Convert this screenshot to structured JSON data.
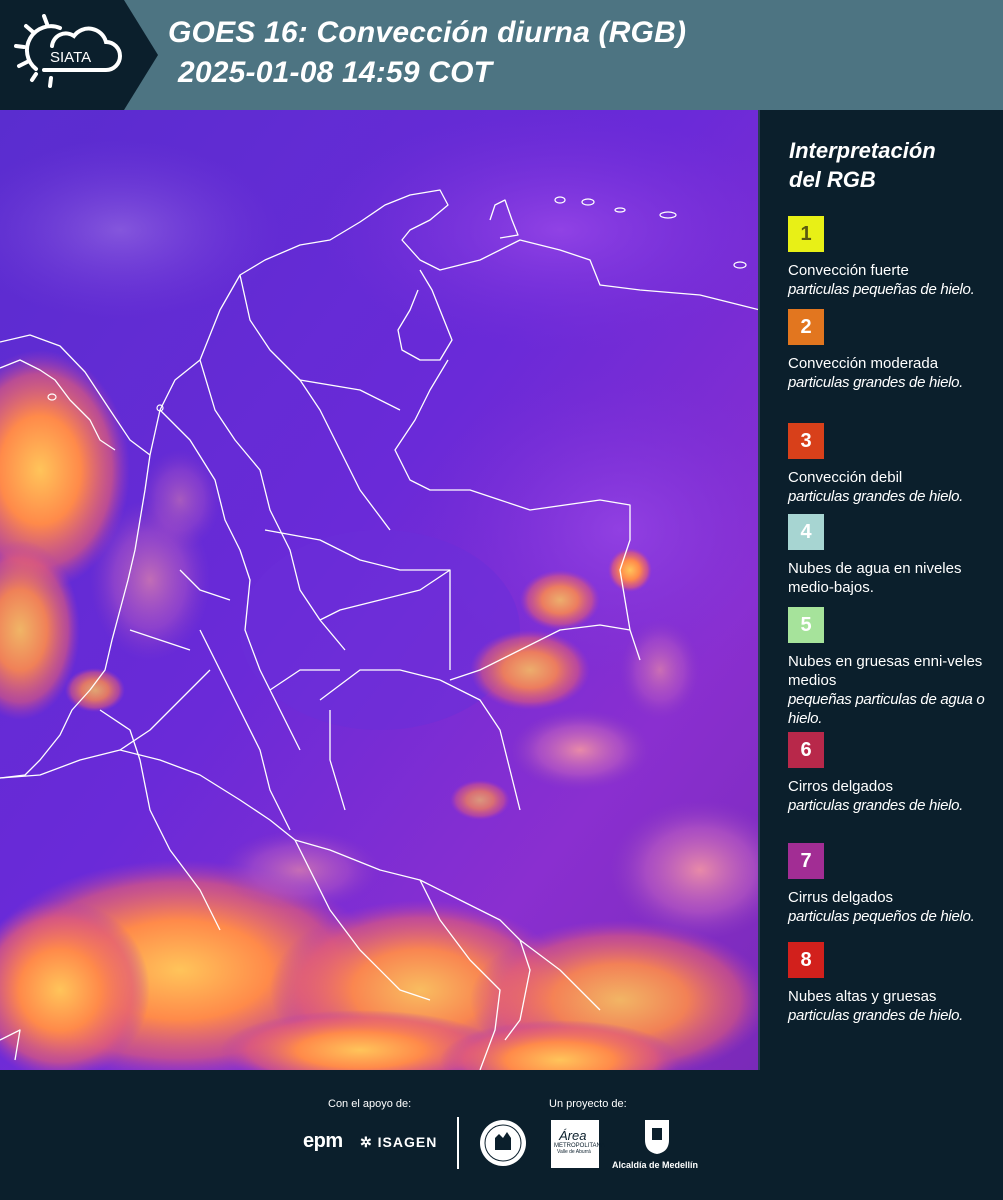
{
  "header": {
    "logo_text": "SIATA",
    "title_line1": "GOES 16: Convección diurna (RGB)",
    "title_line2": "2025-01-08 14:59 COT"
  },
  "legend": {
    "title_line1": "Interpretación",
    "title_line2": "del RGB",
    "items": [
      {
        "number": "1",
        "color": "#e8f016",
        "number_color": "#5a5a10",
        "name": "Convección fuerte",
        "desc": "particulas pequeñas de hielo."
      },
      {
        "number": "2",
        "color": "#e2761f",
        "number_color": "#ffffff",
        "name": "Convección moderada",
        "desc": "particulas grandes de hielo."
      },
      {
        "number": "3",
        "color": "#d8401a",
        "number_color": "#ffffff",
        "name": "Convección debil",
        "desc": "particulas grandes de hielo."
      },
      {
        "number": "4",
        "color": "#a7d5d2",
        "number_color": "#ffffff",
        "name": "Nubes de agua en niveles medio-bajos.",
        "desc": ""
      },
      {
        "number": "5",
        "color": "#a6e39b",
        "number_color": "#ffffff",
        "name": "Nubes en gruesas enni-veles medios",
        "desc": "pequeñas particulas de agua o hielo."
      },
      {
        "number": "6",
        "color": "#b8284a",
        "number_color": "#ffffff",
        "name": "Cirros delgados",
        "desc": "particulas grandes de hielo."
      },
      {
        "number": "7",
        "color": "#a22d94",
        "number_color": "#ffffff",
        "name": "Cirrus delgados",
        "desc": "particulas pequeños de hielo."
      },
      {
        "number": "8",
        "color": "#d2201c",
        "number_color": "#ffffff",
        "name": "Nubes altas y gruesas",
        "desc": "particulas grandes de hielo."
      }
    ]
  },
  "footer": {
    "support_label": "Con el apoyo de:",
    "project_label": "Un proyecto de:",
    "sponsors": [
      "epm",
      "ISAGEN"
    ],
    "project_text": [
      "Área",
      "METROPOLITANA",
      "Valle de Aburrá",
      "Alcaldía de Medellín"
    ]
  }
}
